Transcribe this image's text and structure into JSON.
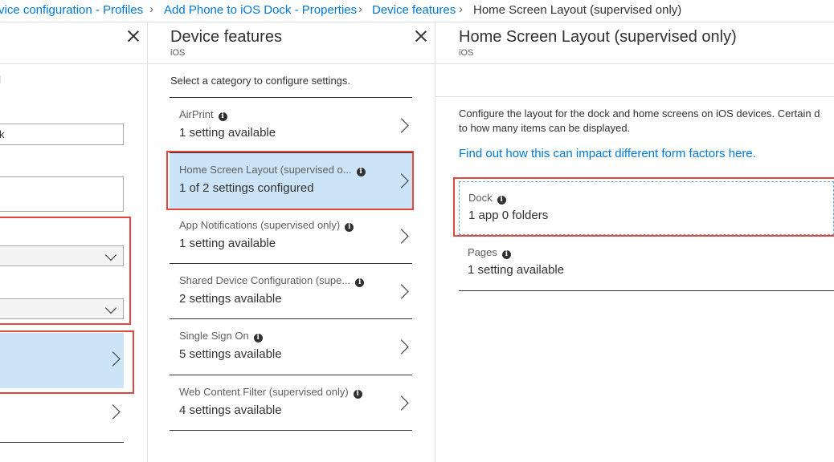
{
  "breadcrumb": [
    {
      "label": "vice configuration - Profiles"
    },
    {
      "label": "Add Phone to iOS Dock - Properties"
    },
    {
      "label": "Device features"
    },
    {
      "label": "Home Screen Layout (supervised only)"
    }
  ],
  "left_blade": {
    "partial_label": "l",
    "name_value": "k"
  },
  "features_blade": {
    "title": "Device features",
    "subtitle": "iOS",
    "instruction": "Select a category to configure settings.",
    "items": [
      {
        "label": "AirPrint",
        "value": "1 setting available"
      },
      {
        "label": "Home Screen Layout (supervised o...",
        "value": "1 of 2 settings configured"
      },
      {
        "label": "App Notifications (supervised only)",
        "value": "1 setting available"
      },
      {
        "label": "Shared Device Configuration (supe...",
        "value": "2 settings available"
      },
      {
        "label": "Single Sign On",
        "value": "5 settings available"
      },
      {
        "label": "Web Content Filter (supervised only)",
        "value": "4 settings available"
      }
    ]
  },
  "layout_blade": {
    "title": "Home Screen Layout (supervised only)",
    "subtitle": "iOS",
    "description_line1": "Configure the layout for the dock and home screens on iOS devices. Certain d",
    "description_line2": "to how many items can be displayed.",
    "link": "Find out how this can impact different form factors here.",
    "dock": {
      "label": "Dock",
      "value": "1 app 0 folders"
    },
    "pages": {
      "label": "Pages",
      "value": "1 setting available"
    }
  },
  "icons": {
    "info": "i"
  },
  "colors": {
    "accent": "#0078d4",
    "highlight": "#cce4f7",
    "annotation": "#e0473e"
  }
}
